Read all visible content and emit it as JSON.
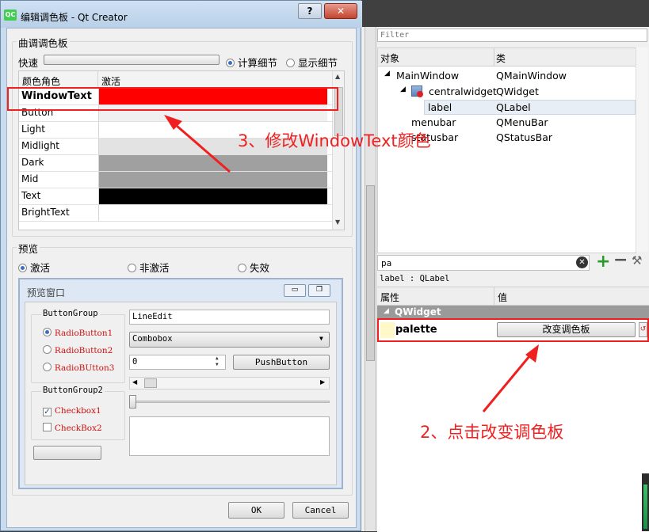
{
  "dialog": {
    "title": "编辑调色板 - Qt Creator",
    "app_icon_text": "QC",
    "help_button": "?",
    "close_button": "✕",
    "tune_group_title": "曲调调色板",
    "quick_label": "快速",
    "compute_details": "计算细节",
    "show_details": "显示细节",
    "roles_header": {
      "role": "颜色角色",
      "active": "激活"
    },
    "roles": [
      {
        "name": "WindowText",
        "color": "#ff0000"
      },
      {
        "name": "Button",
        "color": "#f0f0f0"
      },
      {
        "name": "Light",
        "color": "#ffffff"
      },
      {
        "name": "Midlight",
        "color": "#e3e3e3"
      },
      {
        "name": "Dark",
        "color": "#a0a0a0"
      },
      {
        "name": "Mid",
        "color": "#a0a0a0"
      },
      {
        "name": "Text",
        "color": "#000000"
      },
      {
        "name": "BrightText",
        "color": "#ffffff"
      }
    ],
    "preview_title": "预览",
    "preview_modes": [
      "激活",
      "非激活",
      "失效"
    ],
    "preview_window": {
      "title": "预览窗口",
      "buttongroup1": "ButtonGroup",
      "radios": [
        "RadioButton1",
        "RadioButton2",
        "RadioBUtton3"
      ],
      "buttongroup2": "ButtonGroup2",
      "checks": [
        "Checkbox1",
        "CheckBox2"
      ],
      "lineedit": "LineEdit",
      "combobox": "Combobox",
      "spin_value": "0",
      "pushbutton": "PushButton"
    },
    "ok": "OK",
    "cancel": "Cancel"
  },
  "object_inspector": {
    "filter_placeholder": "Filter",
    "col_object": "对象",
    "col_class": "类",
    "rows": [
      {
        "name": "MainWindow",
        "cls": "QMainWindow"
      },
      {
        "name": "centralwidget",
        "cls": "QWidget"
      },
      {
        "name": "label",
        "cls": "QLabel"
      },
      {
        "name": "menubar",
        "cls": "QMenuBar"
      },
      {
        "name": "statusbar",
        "cls": "QStatusBar"
      }
    ]
  },
  "property_editor": {
    "search_value": "pa",
    "context": "label : QLabel",
    "col_property": "属性",
    "col_value": "值",
    "section": "QWidget",
    "property_name": "palette",
    "change_palette_button": "改变调色板"
  },
  "annotations": {
    "step3": "3、修改WindowText颜色",
    "step2": "2、点击改变调色板"
  },
  "colors": {
    "annotation": "#f02020",
    "highlight_row": "#ff0000"
  }
}
